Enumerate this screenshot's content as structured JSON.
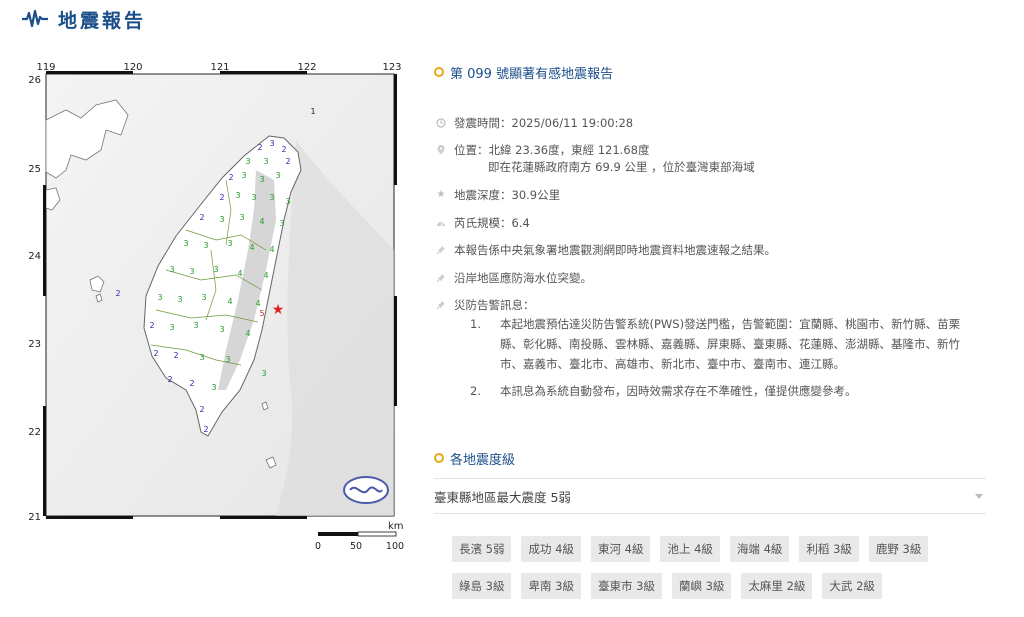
{
  "header": {
    "title": "地震報告",
    "icon": "seismograph-icon"
  },
  "map": {
    "lon_labels": [
      "119",
      "120",
      "121",
      "122",
      "123"
    ],
    "lat_labels": [
      "26",
      "25",
      "24",
      "23",
      "22",
      "21"
    ],
    "scale_unit": "km",
    "scale_labels": [
      "0",
      "50",
      "100"
    ],
    "epicenter_color": "#e0201b"
  },
  "report": {
    "title": "第 099 號顯著有感地震報告",
    "origin_time": "發震時間：2025/06/11 19:00:28",
    "location_line1": "位置：北緯 23.36度，東經 121.68度",
    "location_line2": "即在花蓮縣政府南方 69.9 公里 ，位於臺灣東部海域",
    "depth": "地震深度：30.9公里",
    "magnitude": "芮氏規模：6.4",
    "note1": "本報告係中央氣象署地震觀測網即時地震資料地震速報之結果。",
    "note2": "沿岸地區應防海水位突變。",
    "warning_header": "災防告警訊息：",
    "warnings": [
      {
        "num": "1.",
        "text": "本起地震預估達災防告警系統(PWS)發送門檻，告警範圍：宜蘭縣、桃園市、新竹縣、苗栗縣、彰化縣、南投縣、雲林縣、嘉義縣、屏東縣、臺東縣、花蓮縣、澎湖縣、基隆市、新竹市、嘉義市、臺北市、高雄市、新北市、臺中市、臺南市、連江縣。"
      },
      {
        "num": "2.",
        "text": "本訊息為系統自動發布，因時效需求存在不準確性，僅提供應變參考。"
      }
    ]
  },
  "intensity": {
    "section_title": "各地震度級",
    "selected_region": "臺東縣地區最大震度 5弱",
    "stations": [
      "長濱 5弱",
      "成功 4級",
      "東河 4級",
      "池上 4級",
      "海端 4級",
      "利稻 3級",
      "鹿野 3級",
      "綠島 3級",
      "卑南 3級",
      "臺東市 3級",
      "蘭嶼 3級",
      "太麻里 2級",
      "大武 2級"
    ]
  }
}
